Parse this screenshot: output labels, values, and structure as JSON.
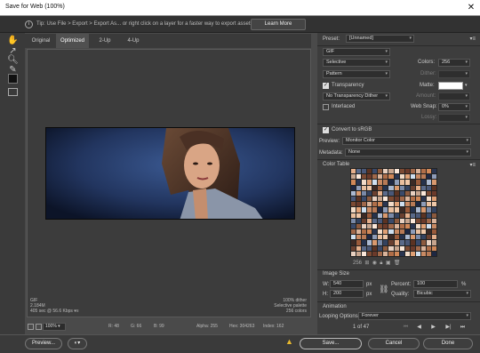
{
  "window": {
    "title": "Save for Web (100%)"
  },
  "tip": {
    "text": "Tip: Use File > Export > Export As... or right click on a layer for a faster way to export assets",
    "learn_more": "Learn More"
  },
  "tabs": [
    "Original",
    "Optimized",
    "2-Up",
    "4-Up"
  ],
  "tools": [
    "hand-icon",
    "slice-select-icon",
    "zoom-icon",
    "eyedropper-icon"
  ],
  "image_info_left": [
    "GIF",
    "2.184M",
    "405 sec @ 56.6 Kbps"
  ],
  "image_info_right": [
    "100% dither",
    "Selective palette",
    "256 colors"
  ],
  "status": {
    "zoom": "100%",
    "r": "R: 48",
    "g": "G: 66",
    "b": "B: 99",
    "alpha": "Alpha: 255",
    "hex": "Hex: 304263",
    "index": "Index: 162"
  },
  "bottom": {
    "preview": "Preview...",
    "save": "Save...",
    "cancel": "Cancel",
    "done": "Done"
  },
  "settings": {
    "preset_label": "Preset:",
    "preset_value": "[Unnamed]",
    "format": "GIF",
    "reduction": "Selective",
    "dither_algo": "Pattern",
    "colors_label": "Colors:",
    "colors_value": "256",
    "dither_label": "Dither:",
    "transparency_label": "Transparency",
    "matte_label": "Matte:",
    "transparency_dither": "No Transparency Dither",
    "amount_label": "Amount:",
    "interlaced_label": "Interlaced",
    "websnap_label": "Web Snap:",
    "websnap_value": "0%",
    "lossy_label": "Lossy:",
    "convert_srgb": "Convert to sRGB",
    "preview_label": "Preview:",
    "preview_value": "Monitor Color",
    "metadata_label": "Metadata:",
    "metadata_value": "None"
  },
  "color_table": {
    "title": "Color Table",
    "count": "256",
    "swatches": [
      "#e6b08c",
      "#c98a63",
      "#8c5a3e",
      "#f0c8a8",
      "#6b3a2a",
      "#d9996e",
      "#2a3550",
      "#5a6a8a",
      "#b87a56",
      "#e8d0c0",
      "#3c2a25",
      "#a0684a",
      "#7a8aa8",
      "#f3dcc8",
      "#4a5878",
      "#1e2742",
      "#c7a58e",
      "#9a5a3a",
      "#dab39a",
      "#33425f",
      "#e0a074",
      "#5c3322",
      "#8e9cb8",
      "#fbe8da",
      "#26324c",
      "#b06e48",
      "#6a4030",
      "#cfe0f0",
      "#3a4a6a",
      "#e9bf9e",
      "#7c4a33",
      "#aab8d0",
      "#d08858"
    ]
  },
  "image_size": {
    "title": "Image Size",
    "w_label": "W:",
    "w_value": "540",
    "h_label": "H:",
    "h_value": "200",
    "unit": "px",
    "percent_label": "Percent:",
    "percent_value": "100",
    "percent_unit": "%",
    "quality_label": "Quality:",
    "quality_value": "Bicubic"
  },
  "animation": {
    "title": "Animation",
    "looping_label": "Looping Options:",
    "looping_value": "Forever",
    "frame_counter": "1 of 47"
  }
}
